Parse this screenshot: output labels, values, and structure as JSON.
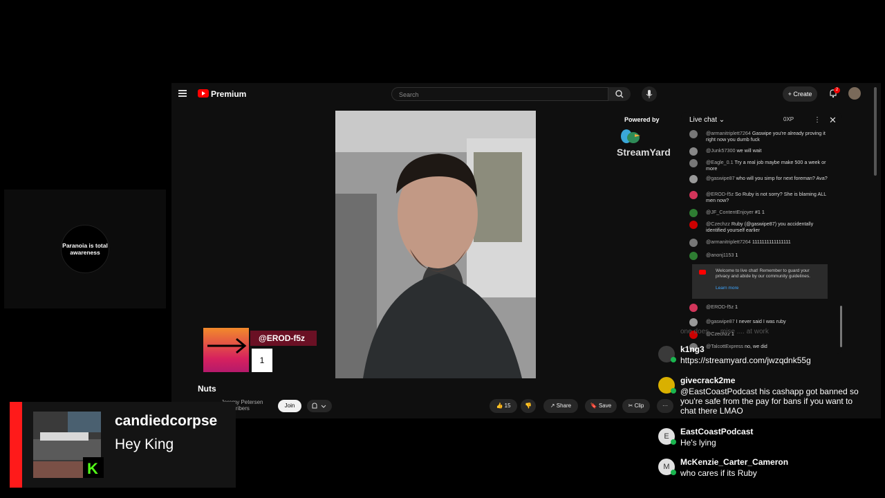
{
  "youtube": {
    "brand": "Premium",
    "search_placeholder": "Search",
    "create_label": "Create",
    "notification_count": "2",
    "powered_by": "Powered by",
    "streamyard": "StreamYard",
    "overlay_handle": "@EROD-f5z",
    "overlay_number": "1",
    "video_title": "Nuts",
    "channel_name": "Jeremy Petersen",
    "channel_subs": "subscribers",
    "join_label": "Join",
    "like_count": "15",
    "share_label": "Share",
    "save_label": "Save",
    "clip_label": "Clip",
    "more_label": "···"
  },
  "live_chat": {
    "title": "Live chat",
    "xp": "0XP",
    "messages": [
      {
        "name": "@armanitriplett7264",
        "text": "Gaswipe you're already proving it right now you dumb fuck",
        "color": "#777"
      },
      {
        "name": "@Junk57300",
        "text": "we will wait",
        "color": "#888"
      },
      {
        "name": "@Eagle_0.1",
        "text": "Try a real job maybe make 500 a week or more",
        "color": "#777"
      },
      {
        "name": "@gaswipe87",
        "text": "who will you simp for next foreman? Ava?",
        "color": "#999"
      },
      {
        "name": "@EROD-f5z",
        "text": "So Ruby is not sorry? She is blaming ALL men now?",
        "color": "#d2355a"
      },
      {
        "name": "@JF_ContentEnjoyer",
        "text": "#1  1",
        "color": "#2e7d32"
      },
      {
        "name": "@Czechzz",
        "text": "Ruby (@gaswipe87) you accidentally identified yourself earlier",
        "color": "#c00"
      },
      {
        "name": "@armanitriplett7264",
        "text": "1111111111111111",
        "color": "#777"
      },
      {
        "name": "@anonj1153",
        "text": "1",
        "color": "#2e7d32"
      }
    ],
    "welcome": "Welcome to live chat! Remember to guard your privacy and abide by our community guidelines.",
    "learn_more": "Learn more",
    "messages2": [
      {
        "name": "@EROD-f5z",
        "text": "1",
        "color": "#d2355a"
      },
      {
        "name": "@gaswipe87",
        "text": "I never said I was ruby",
        "color": "#999"
      },
      {
        "name": "@Czechzz",
        "text": "1",
        "color": "#c00"
      },
      {
        "name": "@TalcottExpress",
        "text": "no, we did",
        "color": "#777"
      }
    ],
    "faded_line": "one does .... mise .... at work"
  },
  "overlay_chat": [
    {
      "name": "k1ng3",
      "text": "https://streamyard.com/jwzqdnk55g",
      "avatar_color": "#3a3a3a"
    },
    {
      "name": "givecrack2me",
      "text": "@EastCoastPodcast his cashapp got banned so you're safe from the pay for bans if you want to chat there LMAO",
      "avatar_color": "#d9b000"
    },
    {
      "name": "EastCoastPodcast",
      "text": "He's lying",
      "avatar_color": "#e0e0e0",
      "initial": "E"
    },
    {
      "name": "McKenzie_Carter_Cameron",
      "text": "who cares if its Ruby",
      "avatar_color": "#e0e0e0",
      "initial": "M"
    }
  ],
  "logo_text": "Paranoia is total awareness",
  "alert": {
    "username": "candiedcorpse",
    "message": "Hey King",
    "platform_letter": "K"
  }
}
